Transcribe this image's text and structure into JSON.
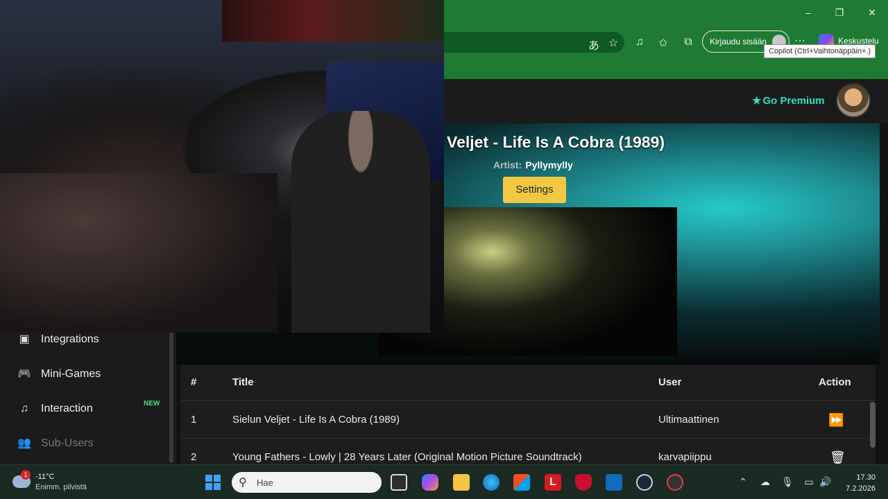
{
  "browser": {
    "window_controls": {
      "minimize": "–",
      "restore": "❐",
      "close": "✕"
    },
    "toolbar_icons": [
      "translate-icon",
      "favorite-star-icon",
      "media-icon",
      "favorites-icon",
      "collections-icon",
      "more-icon"
    ],
    "sign_in_label": "Kirjaudu sisään",
    "more_label": "···",
    "copilot_label": "Keskustelu",
    "tooltip": "Copilot (Ctrl+Vaihtonäppäin+.)"
  },
  "header": {
    "premium_label": "Go Premium",
    "accent_color": "#2fe0c3"
  },
  "now_playing": {
    "title": "Veljet - Life Is A Cobra (1989)",
    "artist_label": "Artist:",
    "artist": "Pyllymylly",
    "settings_label": "Settings"
  },
  "sidebar": {
    "items": [
      {
        "label": "Integrations",
        "icon": "integrations-icon"
      },
      {
        "label": "Mini-Games",
        "icon": "gamepad-icon"
      },
      {
        "label": "Interaction",
        "icon": "music-note-icon",
        "badge": "NEW"
      },
      {
        "label": "Sub-Users",
        "icon": "users-icon"
      }
    ]
  },
  "queue": {
    "columns": [
      "#",
      "Title",
      "User",
      "Action"
    ],
    "rows": [
      {
        "num": "1",
        "title": "Sielun Veljet - Life Is A Cobra (1989)",
        "user": "Ultimaattinen",
        "action": "skip-icon"
      },
      {
        "num": "2",
        "title": "Young Fathers - Lowly | 28 Years Later (Original Motion Picture Soundtrack)",
        "user": "karvapiippu",
        "action": "trash-icon"
      }
    ]
  },
  "taskbar": {
    "weather_badge": "1",
    "temperature": "-11°C",
    "condition": "Enimm. pilvistä",
    "search_placeholder": "Hae",
    "time": "17.30",
    "date": "7.2.2026"
  }
}
